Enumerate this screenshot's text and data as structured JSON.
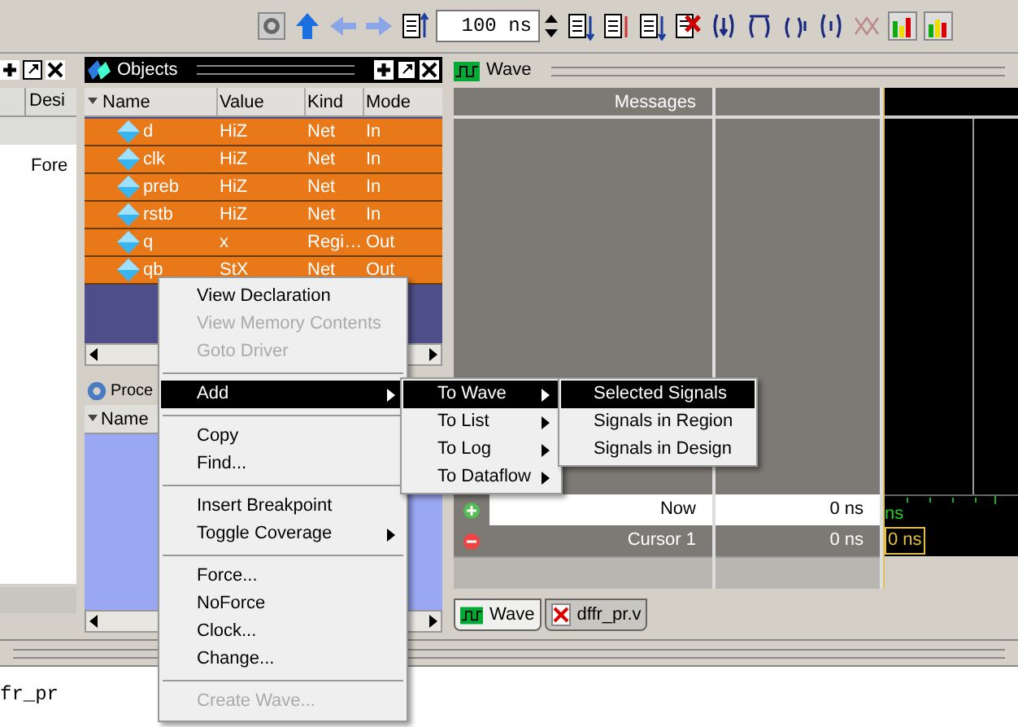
{
  "toolbar": {
    "time_field": "100 ns"
  },
  "left_pane": {
    "columns": [
      "Desi"
    ],
    "cells": [
      "Fore"
    ]
  },
  "objects_pane": {
    "title": "Objects",
    "columns": [
      "Name",
      "Value",
      "Kind",
      "Mode"
    ],
    "rows": [
      {
        "name": "d",
        "value": "HiZ",
        "kind": "Net",
        "mode": "In",
        "selected": true
      },
      {
        "name": "clk",
        "value": "HiZ",
        "kind": "Net",
        "mode": "In",
        "selected": true
      },
      {
        "name": "preb",
        "value": "HiZ",
        "kind": "Net",
        "mode": "In",
        "selected": true
      },
      {
        "name": "rstb",
        "value": "HiZ",
        "kind": "Net",
        "mode": "In",
        "selected": true
      },
      {
        "name": "q",
        "value": "x",
        "kind": "Regi…",
        "mode": "Out",
        "selected": true
      },
      {
        "name": "qb",
        "value": "StX",
        "kind": "Net",
        "mode": "Out",
        "selected": true
      }
    ]
  },
  "process_pane": {
    "title": "Proce",
    "columns": [
      "Name"
    ]
  },
  "wave": {
    "title": "Wave",
    "messages_header": "Messages",
    "cursor_rows": [
      {
        "name": "Now",
        "value": "0 ns",
        "selected": false
      },
      {
        "name": "Cursor 1",
        "value": "0 ns",
        "selected": true
      }
    ],
    "timeline_label": "ns",
    "cursor_label": "0 ns"
  },
  "tabs": [
    {
      "label": "Wave",
      "selected": true
    },
    {
      "label": "dffr_pr.v",
      "selected": false
    }
  ],
  "transcript": {
    "lines": [
      "fr_pr"
    ]
  },
  "context_menu": {
    "items": [
      {
        "kind": "item",
        "label": "View Declaration",
        "disabled": false,
        "submenu": false,
        "selected": false
      },
      {
        "kind": "item",
        "label": "View Memory Contents",
        "disabled": true,
        "submenu": false,
        "selected": false
      },
      {
        "kind": "item",
        "label": "Goto Driver",
        "disabled": true,
        "submenu": false,
        "selected": false
      },
      {
        "kind": "separator"
      },
      {
        "kind": "item",
        "label": "Add",
        "disabled": false,
        "submenu": true,
        "selected": true
      },
      {
        "kind": "separator"
      },
      {
        "kind": "item",
        "label": "Copy",
        "disabled": false,
        "submenu": false,
        "selected": false
      },
      {
        "kind": "item",
        "label": "Find...",
        "disabled": false,
        "submenu": false,
        "selected": false
      },
      {
        "kind": "separator"
      },
      {
        "kind": "item",
        "label": "Insert Breakpoint",
        "disabled": false,
        "submenu": false,
        "selected": false
      },
      {
        "kind": "item",
        "label": "Toggle Coverage",
        "disabled": false,
        "submenu": true,
        "selected": false
      },
      {
        "kind": "separator"
      },
      {
        "kind": "item",
        "label": "Force...",
        "disabled": false,
        "submenu": false,
        "selected": false
      },
      {
        "kind": "item",
        "label": "NoForce",
        "disabled": false,
        "submenu": false,
        "selected": false
      },
      {
        "kind": "item",
        "label": "Clock...",
        "disabled": false,
        "submenu": false,
        "selected": false
      },
      {
        "kind": "item",
        "label": "Change...",
        "disabled": false,
        "submenu": false,
        "selected": false
      },
      {
        "kind": "separator"
      },
      {
        "kind": "item",
        "label": "Create Wave...",
        "disabled": true,
        "submenu": false,
        "selected": false
      }
    ]
  },
  "add_submenu": {
    "items": [
      {
        "label": "To Wave",
        "submenu": true,
        "selected": true
      },
      {
        "label": "To List",
        "submenu": true,
        "selected": false
      },
      {
        "label": "To Log",
        "submenu": true,
        "selected": false
      },
      {
        "label": "To Dataflow",
        "submenu": true,
        "selected": false
      }
    ]
  },
  "wave_submenu": {
    "items": [
      {
        "label": "Selected Signals",
        "selected": true
      },
      {
        "label": "Signals in Region",
        "selected": false
      },
      {
        "label": "Signals in Design",
        "selected": false
      }
    ]
  }
}
